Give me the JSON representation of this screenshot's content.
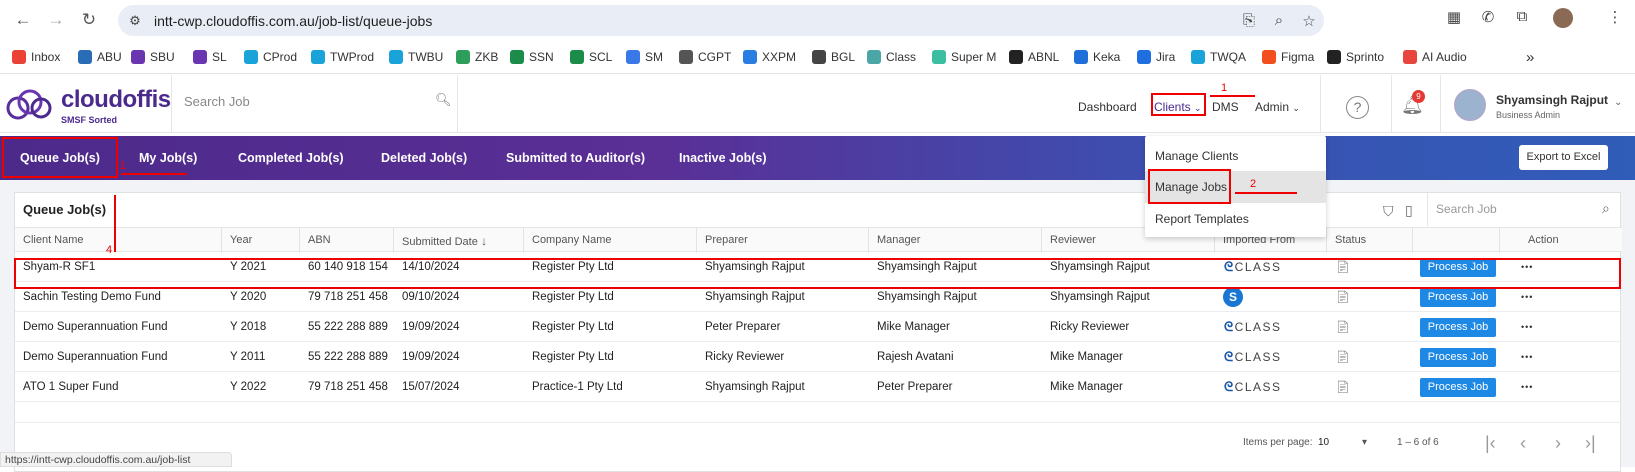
{
  "browser": {
    "url": "intt-cwp.cloudoffis.com.au/job-list/queue-jobs",
    "bookmarks": [
      "Inbox",
      "ABU",
      "SBU",
      "SL",
      "CProd",
      "TWProd",
      "TWBU",
      "ZKB",
      "SSN",
      "SCL",
      "SM",
      "CGPT",
      "XXPM",
      "BGL",
      "Class",
      "Super M",
      "ABNL",
      "Keka",
      "Jira",
      "TWQA",
      "Figma",
      "Sprinto",
      "AI Audio"
    ],
    "status_url": "https://intt-cwp.cloudoffis.com.au/job-list"
  },
  "header": {
    "logo_name": "cloudoffis",
    "logo_tag": "SMSF Sorted",
    "search_placeholder": "Search Job",
    "nav": {
      "dashboard": "Dashboard",
      "clients": "Clients",
      "dms": "DMS",
      "admin": "Admin"
    },
    "notifications": "9",
    "user_name": "Shyamsingh Rajput",
    "user_role": "Business Admin"
  },
  "tabs": [
    "Queue Job(s)",
    "My Job(s)",
    "Completed Job(s)",
    "Deleted Job(s)",
    "Submitted to Auditor(s)",
    "Inactive Job(s)"
  ],
  "export_label": "Export to Excel",
  "dropdown": [
    "Manage Clients",
    "Manage Jobs",
    "Report Templates"
  ],
  "table": {
    "title": "Queue Job(s)",
    "search_placeholder": "Search Job",
    "columns": [
      "Client Name",
      "Year",
      "ABN",
      "Submitted Date",
      "Company Name",
      "Preparer",
      "Manager",
      "Reviewer",
      "Imported From",
      "Status",
      "",
      "Action"
    ],
    "rows": [
      {
        "client": "Shyam-R SF1",
        "year": "Y 2021",
        "abn": "60 140 918 154",
        "date": "14/10/2024",
        "company": "Register Pty Ltd",
        "preparer": "Shyamsingh Rajput",
        "manager": "Shyamsingh Rajput",
        "reviewer": "Shyamsingh Rajput",
        "imported": "class"
      },
      {
        "client": "Sachin Testing Demo Fund",
        "year": "Y 2020",
        "abn": "79 718 251 458",
        "date": "09/10/2024",
        "company": "Register Pty Ltd",
        "preparer": "Shyamsingh Rajput",
        "manager": "Shyamsingh Rajput",
        "reviewer": "Shyamsingh Rajput",
        "imported": "circle"
      },
      {
        "client": "Demo Superannuation Fund",
        "year": "Y 2018",
        "abn": "55 222 288 889",
        "date": "19/09/2024",
        "company": "Register Pty Ltd",
        "preparer": "Peter Preparer",
        "manager": "Mike Manager",
        "reviewer": "Ricky Reviewer",
        "imported": "class"
      },
      {
        "client": "Demo Superannuation Fund",
        "year": "Y 2011",
        "abn": "55 222 288 889",
        "date": "19/09/2024",
        "company": "Register Pty Ltd",
        "preparer": "Ricky Reviewer",
        "manager": "Rajesh Avatani",
        "reviewer": "Mike Manager",
        "imported": "class"
      },
      {
        "client": "ATO 1 Super Fund",
        "year": "Y 2022",
        "abn": "79 718 251 458",
        "date": "15/07/2024",
        "company": "Practice-1 Pty Ltd",
        "preparer": "Shyamsingh Rajput",
        "manager": "Peter Preparer",
        "reviewer": "Mike Manager",
        "imported": "class"
      }
    ],
    "process_label": "Process Job",
    "class_text": "CLASS",
    "items_per_page_label": "Items per page:",
    "items_per_page": "10",
    "range": "1 – 6 of 6"
  },
  "annotations": [
    "1",
    "2",
    "1",
    "4"
  ]
}
